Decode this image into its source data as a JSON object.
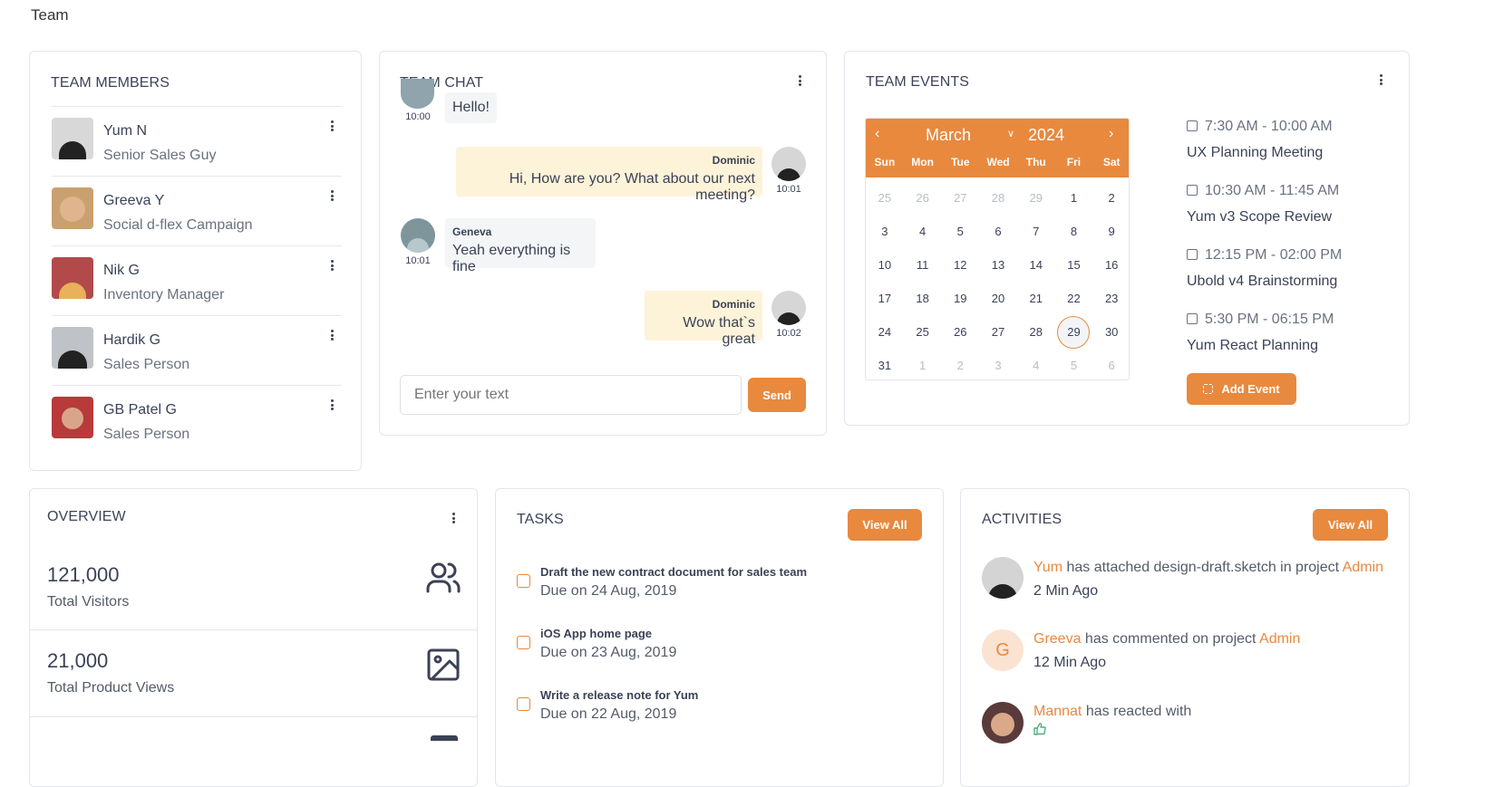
{
  "page": {
    "title": "Team"
  },
  "members": {
    "title": "TEAM MEMBERS",
    "items": [
      {
        "name": "Yum N",
        "role": "Senior Sales Guy"
      },
      {
        "name": "Greeva Y",
        "role": "Social d-flex Campaign"
      },
      {
        "name": "Nik G",
        "role": "Inventory Manager"
      },
      {
        "name": "Hardik G",
        "role": "Sales Person"
      },
      {
        "name": "GB Patel G",
        "role": "Sales Person"
      }
    ]
  },
  "chat": {
    "title": "TEAM CHAT",
    "messages": [
      {
        "text": "Hello!",
        "time": "10:00"
      },
      {
        "sender": "Dominic",
        "text": "Hi, How are you? What about our next meeting?",
        "time": "10:01"
      },
      {
        "sender": "Geneva",
        "text": "Yeah everything is fine",
        "time": "10:01"
      },
      {
        "sender": "Dominic",
        "text": "Wow that`s great",
        "time": "10:02"
      }
    ],
    "input_placeholder": "Enter your text",
    "send_label": "Send"
  },
  "events": {
    "title": "TEAM EVENTS",
    "calendar": {
      "month": "March",
      "year": "2024",
      "weekdays": [
        "Sun",
        "Mon",
        "Tue",
        "Wed",
        "Thu",
        "Fri",
        "Sat"
      ],
      "weeks": [
        [
          "25",
          "26",
          "27",
          "28",
          "29",
          "1",
          "2"
        ],
        [
          "3",
          "4",
          "5",
          "6",
          "7",
          "8",
          "9"
        ],
        [
          "10",
          "11",
          "12",
          "13",
          "14",
          "15",
          "16"
        ],
        [
          "17",
          "18",
          "19",
          "20",
          "21",
          "22",
          "23"
        ],
        [
          "24",
          "25",
          "26",
          "27",
          "28",
          "29",
          "30"
        ],
        [
          "31",
          "1",
          "2",
          "3",
          "4",
          "5",
          "6"
        ]
      ],
      "selected": "29"
    },
    "list": [
      {
        "time": "7:30 AM - 10:00 AM",
        "name": "UX Planning Meeting"
      },
      {
        "time": "10:30 AM - 11:45 AM",
        "name": "Yum v3 Scope Review"
      },
      {
        "time": "12:15 PM - 02:00 PM",
        "name": "Ubold v4 Brainstorming"
      },
      {
        "time": "5:30 PM - 06:15 PM",
        "name": "Yum React Planning"
      }
    ],
    "add_label": "Add Event"
  },
  "overview": {
    "title": "OVERVIEW",
    "stats": [
      {
        "value": "121,000",
        "label": "Total Visitors",
        "icon": "users-icon"
      },
      {
        "value": "21,000",
        "label": "Total Product Views",
        "icon": "image-icon"
      }
    ]
  },
  "tasks": {
    "title": "TASKS",
    "view_all": "View All",
    "items": [
      {
        "name": "Draft the new contract document for sales team",
        "due": "Due on 24 Aug, 2019"
      },
      {
        "name": "iOS App home page",
        "due": "Due on 23 Aug, 2019"
      },
      {
        "name": "Write a release note for Yum",
        "due": "Due on 22 Aug, 2019"
      }
    ]
  },
  "activities": {
    "title": "ACTIVITIES",
    "view_all": "View All",
    "items": [
      {
        "user": "Yum",
        "text": " has attached design-draft.sketch in project ",
        "project": "Admin",
        "time": "2 Min Ago"
      },
      {
        "user": "Greeva",
        "text": " has commented on project ",
        "project": "Admin",
        "time": "12 Min Ago",
        "initial": "G"
      },
      {
        "user": "Mannat",
        "text": " has reacted with",
        "project": ""
      }
    ]
  },
  "colors": {
    "accent": "#e8893e",
    "bubble_me": "#fdf3d9",
    "bubble_them": "#f4f5f7"
  }
}
